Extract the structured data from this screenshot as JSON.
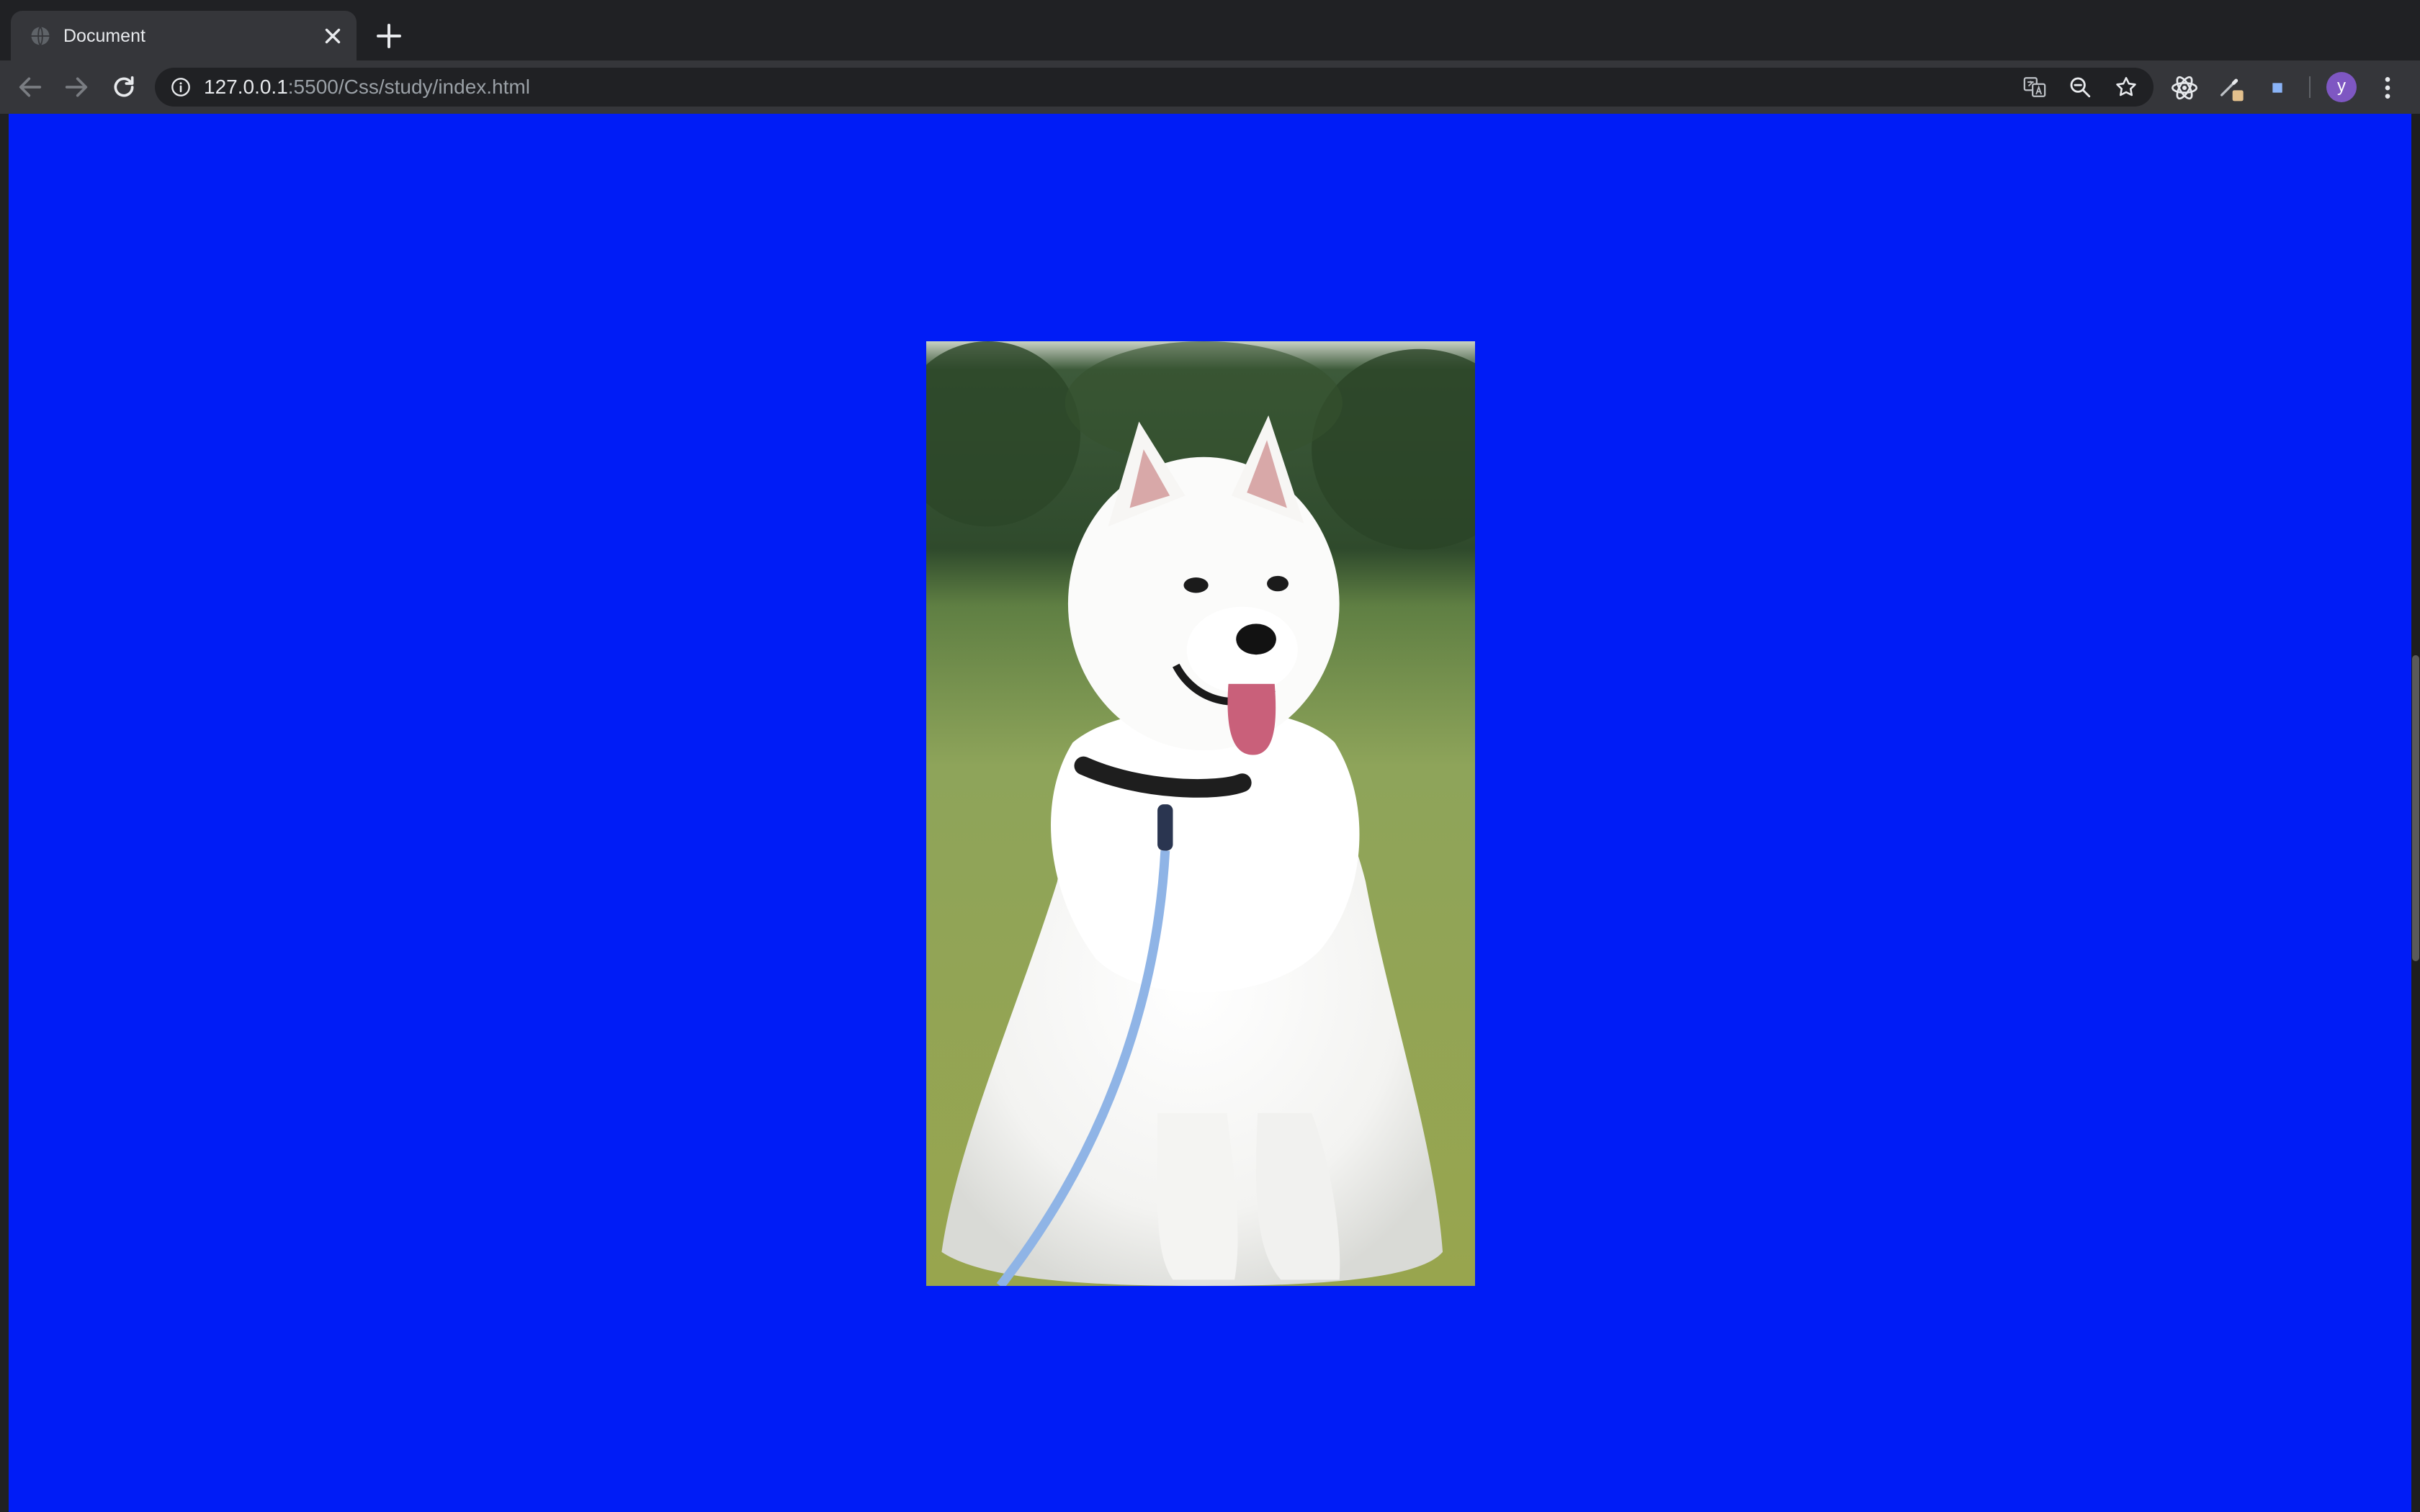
{
  "browser": {
    "tab": {
      "title": "Document"
    },
    "address_bar": {
      "host": "127.0.0.1",
      "path": ":5500/Css/study/index.html"
    },
    "profile_initial": "y"
  },
  "icons": {
    "tab_favicon": "globe-icon",
    "tab_close": "close-icon",
    "new_tab": "plus-icon",
    "back": "back-arrow-icon",
    "forward": "forward-arrow-icon",
    "reload": "reload-icon",
    "site_info": "info-icon",
    "translate": "translate-icon",
    "zoom": "zoom-out-icon",
    "bookmark": "star-icon",
    "react_devtools": "atom-icon",
    "pen_extension": "pen-icon",
    "square_extension": "square-icon",
    "menu": "kebab-menu-icon"
  },
  "page": {
    "background_color": "#001cf6",
    "image": {
      "subject": "white samoyed dog sitting on grass with a blue leash"
    }
  },
  "colors": {
    "chrome_dark": "#202124",
    "toolbar": "#35363a",
    "avatar": "#7e57c2"
  }
}
